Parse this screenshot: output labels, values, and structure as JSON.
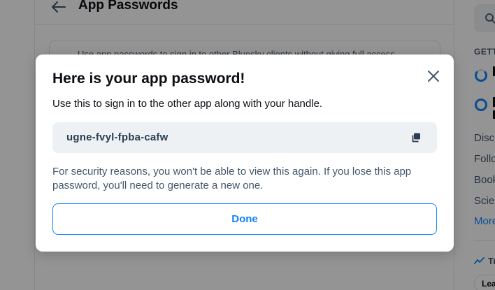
{
  "background": {
    "page_title": "App Passwords",
    "info_text": "Use app passwords to sign in to other Bluesky clients without giving full access",
    "sidebar": {
      "section_label": "GETT",
      "feeds": [
        "Disc",
        "Follo",
        "Book",
        "Scie"
      ],
      "more_label": "More",
      "trending_label": "Tr",
      "trending_chip": "Lea"
    }
  },
  "modal": {
    "title": "Here is your app password!",
    "subtitle": "Use this to sign in to the other app along with your handle.",
    "password": "ugne-fvyl-fpba-cafw",
    "warning": "For security reasons, you won't be able to view this again. If you lose this app password, you'll need to generate a new one.",
    "done_label": "Done"
  },
  "icons": {
    "close": "close-icon",
    "copy": "copy-icon",
    "back": "arrow-left-icon",
    "search": "search-icon",
    "trending": "trending-icon"
  },
  "colors": {
    "accent": "#1083fe",
    "text": "#0b0f14",
    "muted": "#42576c",
    "field_bg": "#eef1f4"
  }
}
